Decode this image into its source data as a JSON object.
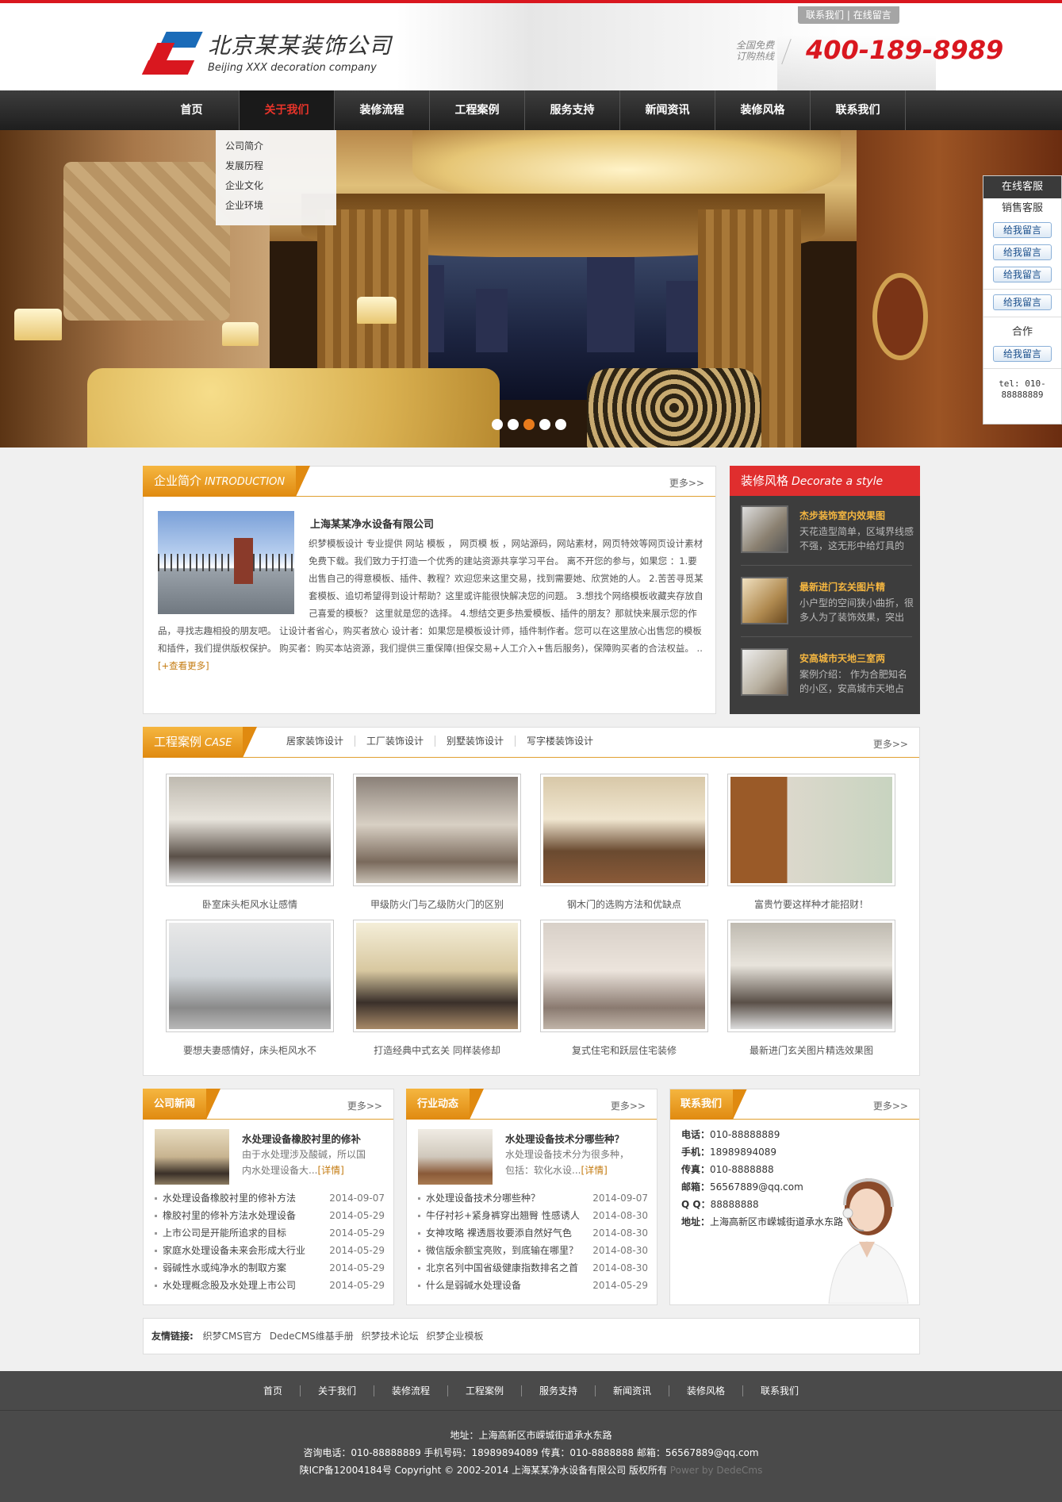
{
  "header": {
    "top_links": [
      "联系我们",
      "在线留言"
    ],
    "company_name_cn": "北京某某装饰公司",
    "company_name_en": "Beijing XXX decoration company",
    "hotline_label_1": "全国免费",
    "hotline_label_2": "订购热线",
    "phone": "400-189-8989"
  },
  "nav": {
    "items": [
      "首页",
      "关于我们",
      "装修流程",
      "工程案例",
      "服务支持",
      "新闻资讯",
      "装修风格",
      "联系我们"
    ],
    "active": "关于我们",
    "dropdown": [
      "公司简介",
      "发展历程",
      "企业文化",
      "企业环境"
    ]
  },
  "banner": {
    "slide_count": 5,
    "active_slide": 3
  },
  "kefu": {
    "title": "在线客服",
    "sales_label": "销售客服",
    "button_label": "给我留言",
    "coop_label": "合作",
    "tel": "tel: 010-88888889"
  },
  "intro": {
    "title_cn": "企业简介",
    "title_en": "INTRODUCTION",
    "more": "更多>>",
    "company": "上海某某净水设备有限公司",
    "text": "织梦模板设计 专业提供 网站 模板 ， 网页模 板 ，网站源码，网站素材，网页特效等网页设计素材免费下载。我们致力于打造一个优秀的建站资源共享学习平台。 离不开您的参与，如果您 ：1.要出售自己的得意模板、插件、教程？欢迎您来这里交易，找到需要她、欣赏她的人。 2.苦苦寻觅某套模板、追切希望得到设计帮助？这里或许能很快解决您的问题。 3.想找个网络模板收藏夹存放自己喜爱的模板？ 这里就是您的选择。 4.想结交更多热爱模板、插件的朋友？那就快来展示您的作品，寻找志趣相投的朋友吧。 让设计者省心，购买者放心 设计者：如果您是模板设计师，插件制作者。您可以在这里放心出售您的模板和插件，我们提供版权保护。 购买者：购买本站资源，我们提供三重保障(担保交易+人工介入+售后服务)，保障购买者的合法权益。 .. ",
    "read_more": "[+查看更多]"
  },
  "style": {
    "title_cn": "装修风格",
    "title_en": "Decorate a style",
    "items": [
      {
        "title": "杰步装饰室内效果图",
        "desc": "天花造型简单，区域界线感不强，这无形中给灯具的"
      },
      {
        "title": "最新进门玄关图片精",
        "desc": "小户型的空间狭小曲折，很多人为了装饰效果，突出"
      },
      {
        "title": "安高城市天地三室两",
        "desc": "案例介绍： 作为合肥知名的小区，安高城市天地占"
      }
    ]
  },
  "cases": {
    "title_cn": "工程案例",
    "title_en": "CASE",
    "tabs": [
      "居家装饰设计",
      "工厂装饰设计",
      "别墅装饰设计",
      "写字楼装饰设计"
    ],
    "more": "更多>>",
    "items": [
      "卧室床头柜风水让感情",
      "甲级防火门与乙级防火门的区别",
      "钢木门的选购方法和优缺点",
      "富贵竹要这样种才能招财！",
      "要想夫妻感情好，床头柜风水不",
      "打造经典中式玄关 同样装修却",
      "复式住宅和跃层住宅装修",
      "最新进门玄关图片精选效果图"
    ]
  },
  "news": {
    "title": "公司新闻",
    "more": "更多>>",
    "featured_title": "水处理设备橡胶衬里的修补",
    "featured_desc": "由于水处理涉及酸碱，所以国内水处理设备大...",
    "detail": "[详情]",
    "list": [
      {
        "t": "水处理设备橡胶衬里的修补方法",
        "d": "2014-09-07"
      },
      {
        "t": "橡胶衬里的修补方法水处理设备",
        "d": "2014-05-29"
      },
      {
        "t": "上市公司是开能所追求的目标",
        "d": "2014-05-29"
      },
      {
        "t": "家庭水处理设备未来会形成大行业",
        "d": "2014-05-29"
      },
      {
        "t": "弱碱性水或纯净水的制取方案",
        "d": "2014-05-29"
      },
      {
        "t": "水处理概念股及水处理上市公司",
        "d": "2014-05-29"
      }
    ]
  },
  "industry": {
    "title": "行业动态",
    "more": "更多>>",
    "featured_title": "水处理设备技术分哪些种？",
    "featured_desc": "水处理设备技术分为很多种，包括：软化水设...",
    "detail": "[详情]",
    "list": [
      {
        "t": "水处理设备技术分哪些种？",
        "d": "2014-09-07"
      },
      {
        "t": "牛仔衬衫+紧身裤穿出翘臀 性感诱人",
        "d": "2014-08-30"
      },
      {
        "t": "女神攻略 裸透唇妆要添自然好气色",
        "d": "2014-08-30"
      },
      {
        "t": "微信版余额宝亮败，到底输在哪里？",
        "d": "2014-08-30"
      },
      {
        "t": "北京名列中国省级健康指数排名之首",
        "d": "2014-08-30"
      },
      {
        "t": "什么是弱碱水处理设备",
        "d": "2014-05-29"
      }
    ]
  },
  "contact": {
    "title": "联系我们",
    "more": "更多>>",
    "lines": [
      {
        "k": "电话：",
        "v": "010-88888889"
      },
      {
        "k": "手机：",
        "v": "18989894089"
      },
      {
        "k": "传真：",
        "v": "010-8888888"
      },
      {
        "k": "邮箱：",
        "v": "56567889@qq.com"
      },
      {
        "k": "Q Q：",
        "v": "88888888"
      },
      {
        "k": "地址：",
        "v": "上海高新区市嵘城街道承水东路"
      }
    ]
  },
  "links": {
    "label": "友情链接:",
    "items": [
      "织梦CMS官方",
      "DedeCMS维基手册",
      "织梦技术论坛",
      "织梦企业模板"
    ]
  },
  "footer": {
    "nav": [
      "首页",
      "关于我们",
      "装修流程",
      "工程案例",
      "服务支持",
      "新闻资讯",
      "装修风格",
      "联系我们"
    ],
    "address": "地址：上海高新区市嵘城街道承水东路",
    "contact": "咨询电话：010-88888889 手机号码：18989894089 传真：010-8888888 邮箱：56567889@qq.com",
    "copyright": "陕ICP备12004184号 Copyright © 2002-2014 上海某某净水设备有限公司 版权所有",
    "powered": "Power by DedeCms"
  }
}
